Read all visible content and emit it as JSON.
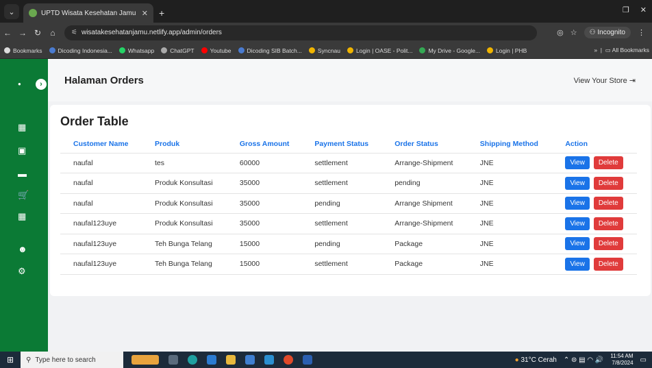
{
  "browser": {
    "tab_title": "UPTD Wisata Kesehatan Jamu",
    "url": "wisatakesehatanjamu.netlify.app/admin/orders",
    "incognito_label": "Incognito",
    "bookmarks": [
      {
        "label": "Bookmarks",
        "color": "#dcdcdc"
      },
      {
        "label": "Dicoding Indonesia...",
        "color": "#4a7bd0"
      },
      {
        "label": "Whatsapp",
        "color": "#25d366"
      },
      {
        "label": "ChatGPT",
        "color": "#aaaaaa"
      },
      {
        "label": "Youtube",
        "color": "#ff0000"
      },
      {
        "label": "Dicoding SIB Batch...",
        "color": "#4a7bd0"
      },
      {
        "label": "Syncnau",
        "color": "#f0b400"
      },
      {
        "label": "Login | OASE - Polit...",
        "color": "#f0b400"
      },
      {
        "label": "My Drive - Google...",
        "color": "#34a853"
      },
      {
        "label": "Login | PHB",
        "color": "#f0b400"
      }
    ],
    "all_bookmarks": "All Bookmarks"
  },
  "header": {
    "title": "Halaman Orders",
    "store_link": "View Your Store"
  },
  "card": {
    "title": "Order Table"
  },
  "table": {
    "columns": [
      "Customer Name",
      "Produk",
      "Gross Amount",
      "Payment Status",
      "Order Status",
      "Shipping Method",
      "Action"
    ],
    "rows": [
      [
        "naufal",
        "tes",
        "60000",
        "settlement",
        "Arrange-Shipment",
        "JNE"
      ],
      [
        "naufal",
        "Produk Konsultasi",
        "35000",
        "settlement",
        "pending",
        "JNE"
      ],
      [
        "naufal",
        "Produk Konsultasi",
        "35000",
        "pending",
        "Arrange Shipment",
        "JNE"
      ],
      [
        "naufal123uye",
        "Produk Konsultasi",
        "35000",
        "settlement",
        "Arrange-Shipment",
        "JNE"
      ],
      [
        "naufal123uye",
        "Teh Bunga Telang",
        "15000",
        "pending",
        "Package",
        "JNE"
      ],
      [
        "naufal123uye",
        "Teh Bunga Telang",
        "15000",
        "settlement",
        "Package",
        "JNE"
      ]
    ],
    "view_label": "View",
    "delete_label": "Delete"
  },
  "taskbar": {
    "search_placeholder": "Type here to search",
    "weather": "31°C Cerah",
    "time": "11:54 AM",
    "date": "7/8/2024"
  },
  "colors": {
    "sidebar": "#0b7a35",
    "link": "#1a73e8",
    "delete": "#e03b3b"
  }
}
